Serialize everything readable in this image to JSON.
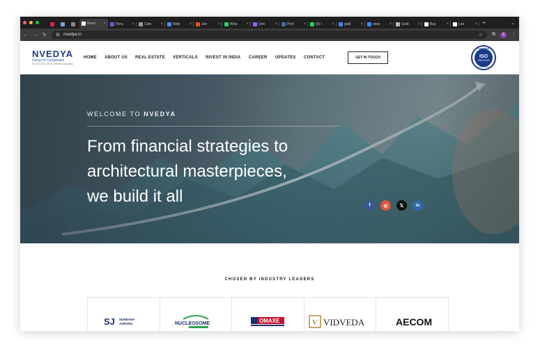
{
  "browser": {
    "tabs": [
      {
        "label": "",
        "icon": "slack-icon",
        "color": "#e01e5a"
      },
      {
        "label": "",
        "icon": "feather-icon",
        "color": "#6fa8dc"
      },
      {
        "label": "",
        "icon": "a-icon",
        "color": "#888888"
      },
      {
        "label": "Nved",
        "icon": "page-icon",
        "color": "#ffffff",
        "active": true
      },
      {
        "label": "Pera",
        "icon": "pera-icon",
        "color": "#6b5bd2"
      },
      {
        "label": "Colo",
        "icon": "globe-icon",
        "color": "#999999"
      },
      {
        "label": "Web",
        "icon": "doc-icon",
        "color": "#4a8af4"
      },
      {
        "label": "Job",
        "icon": "figma-icon",
        "color": "#f24e1e"
      },
      {
        "label": "Wha",
        "icon": "whatsapp-icon",
        "color": "#25d366"
      },
      {
        "label": "Unti",
        "icon": "figma-icon",
        "color": "#a259ff"
      },
      {
        "label": "Prof",
        "icon": "shield-icon",
        "color": "#3a6ea5"
      },
      {
        "label": "(5) I",
        "icon": "whatsapp-icon",
        "color": "#25d366"
      },
      {
        "label": "gold",
        "icon": "google-icon",
        "color": "#4285f4"
      },
      {
        "label": "zene",
        "icon": "google-icon",
        "color": "#4285f4"
      },
      {
        "label": "Gold",
        "icon": "star-icon",
        "color": "#bbbbbb"
      },
      {
        "label": "Buy",
        "icon": "page-icon",
        "color": "#ffffff"
      },
      {
        "label": "Lea",
        "icon": "page-icon",
        "color": "#ffffff"
      }
    ],
    "url": "nvedya.in",
    "profile_initial": "S"
  },
  "header": {
    "logo_name": "NVEDYA",
    "logo_sub": "Group of Companies",
    "logo_sub2": "An ISO 9001:2015 Certified Company",
    "nav": [
      "HOME",
      "ABOUT US",
      "REAL ESTATE",
      "VERTICALS",
      "INVEST IN INDIA",
      "CAREER",
      "UPDATES",
      "CONTACT"
    ],
    "cta": "GET IN TOUCH",
    "iso": {
      "top": "CERTIFIED",
      "big": "ISO",
      "num": "9001:2015",
      "bottom": "COMPANY"
    }
  },
  "hero": {
    "welcome_prefix": "WELCOME TO ",
    "welcome_brand": "NVEDYA",
    "headline_line1": "From financial strategies to",
    "headline_line2": "architectural masterpieces,",
    "headline_line3": "we build it all",
    "social": [
      {
        "name": "facebook-icon",
        "glyph": "f",
        "color": "#3b5998"
      },
      {
        "name": "instagram-icon",
        "glyph": "◎",
        "color": "#e1573c"
      },
      {
        "name": "x-icon",
        "glyph": "𝕏",
        "color": "#111111"
      },
      {
        "name": "linkedin-icon",
        "glyph": "in",
        "color": "#2e6aa8"
      }
    ]
  },
  "clients": {
    "heading": "CHOSEN BY INDUSTRY LEADERS",
    "logos": [
      {
        "label": "SJ SURBANA JURONG"
      },
      {
        "label": "NUCLEOSOME"
      },
      {
        "label": "OMAXE"
      },
      {
        "label": "VIDVEDA"
      },
      {
        "label": "AECOM"
      }
    ]
  }
}
